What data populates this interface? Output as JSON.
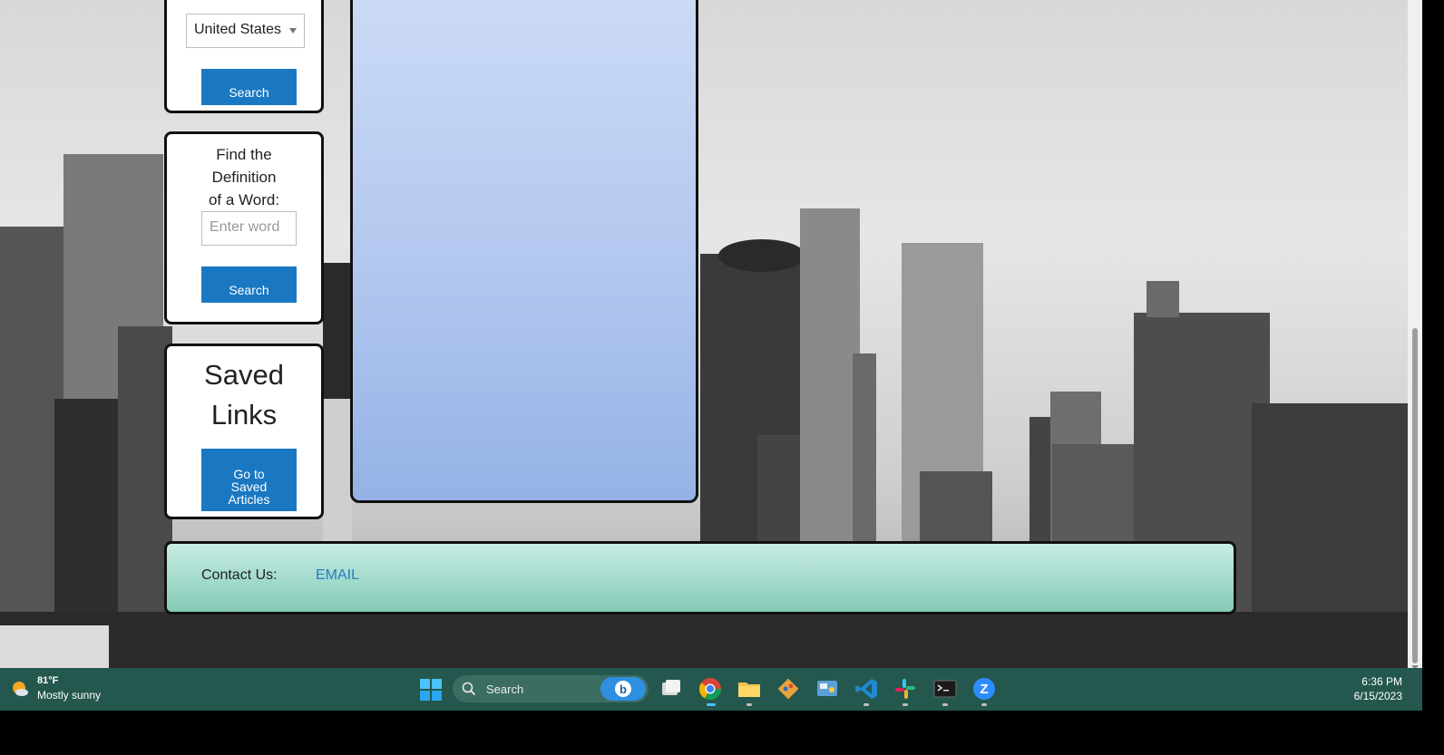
{
  "country_card": {
    "selected_country": "United States",
    "search_label": "Search"
  },
  "define_card": {
    "title_line1": "Find the",
    "title_line2": "Definition",
    "title_line3": "of a Word:",
    "word_placeholder": "Enter word",
    "search_label": "Search"
  },
  "saved_card": {
    "title_line1": "Saved",
    "title_line2": "Links",
    "button_line1": "Go to",
    "button_line2": "Saved",
    "button_line3": "Articles"
  },
  "footer": {
    "contact_label": "Contact Us:",
    "email_label": "EMAIL"
  },
  "taskbar": {
    "weather_temp": "81°F",
    "weather_desc": "Mostly sunny",
    "search_label": "Search",
    "time": "6:36 PM",
    "date": "6/15/2023",
    "apps": [
      "task-view",
      "chrome",
      "file-explorer",
      "git",
      "control-panel",
      "vscode",
      "slack",
      "terminal",
      "zoom"
    ]
  },
  "colors": {
    "button_blue": "#1a78c2",
    "panel_blue": "#b5c9f0",
    "footer_teal": "#a4dccd",
    "taskbar": "#24584e"
  }
}
